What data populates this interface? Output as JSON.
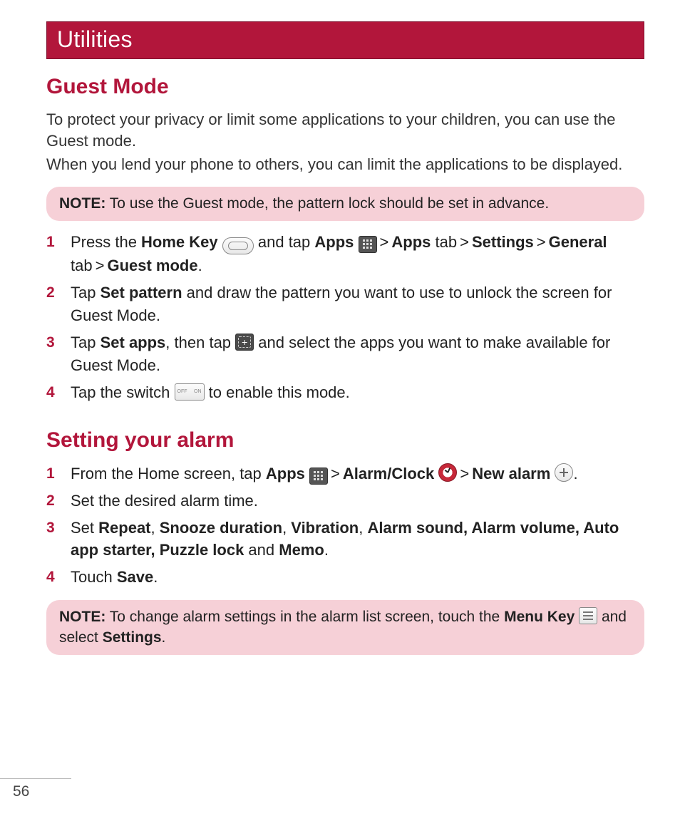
{
  "banner": "Utilities",
  "page_number": "56",
  "guest_mode": {
    "heading": "Guest Mode",
    "p1": "To protect your privacy or limit some applications to your children, you can use the Guest mode.",
    "p2": "When you lend your phone to others, you can limit the applications to be displayed.",
    "note_label": "NOTE:",
    "note_text": " To use the Guest mode, the pattern lock should be set in advance.",
    "steps": {
      "s1": {
        "a": "Press the ",
        "home_key": "Home Key",
        "b": " and tap ",
        "apps": "Apps",
        "c": "Apps",
        "c2": " tab",
        "settings": "Settings",
        "general": "General",
        "d": " tab",
        "guest_mode": "Guest mode",
        "period": "."
      },
      "s2": {
        "a": "Tap ",
        "set_pattern": "Set pattern",
        "b": " and draw the pattern you want to use to unlock the screen for Guest Mode."
      },
      "s3": {
        "a": "Tap ",
        "set_apps": "Set apps",
        "b": ", then tap ",
        "c": " and select the apps you want to make available for Guest Mode."
      },
      "s4": {
        "a": "Tap the switch ",
        "b": " to enable this mode."
      }
    }
  },
  "alarm": {
    "heading": "Setting your alarm",
    "steps": {
      "s1": {
        "a": "From the Home screen, tap ",
        "apps": "Apps",
        "alarm_clock": "Alarm/Clock",
        "new_alarm": "New alarm",
        "period": "."
      },
      "s2": {
        "a": "Set the desired alarm time."
      },
      "s3": {
        "a": "Set ",
        "repeat": "Repeat",
        "c1": ", ",
        "snooze": "Snooze duration",
        "c2": ", ",
        "vibration": "Vibration",
        "c3": ", ",
        "sound": "Alarm sound, Alarm volume, Auto app starter, Puzzle lock",
        "and": " and ",
        "memo": "Memo",
        "period": "."
      },
      "s4": {
        "a": "Touch ",
        "save": "Save",
        "period": "."
      }
    },
    "note_label": "NOTE:",
    "note_a": " To change alarm settings in the alarm list screen, touch the ",
    "note_menu": "Menu Key",
    "note_b": " and select ",
    "note_settings": "Settings",
    "note_period": "."
  }
}
